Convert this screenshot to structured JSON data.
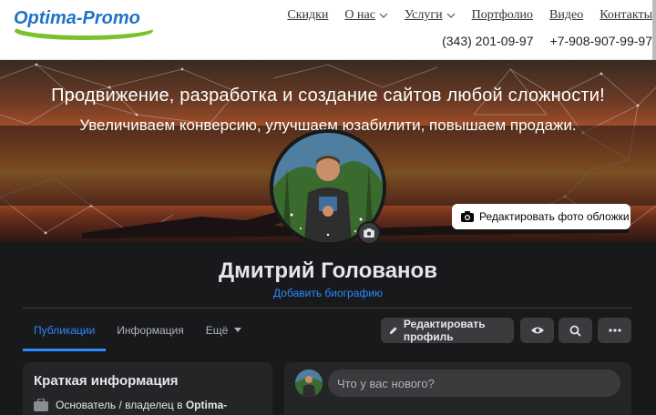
{
  "header": {
    "logo_text": "Optima-Promo",
    "nav": [
      {
        "label": "Скидки",
        "dropdown": false
      },
      {
        "label": "О нас",
        "dropdown": true
      },
      {
        "label": "Услуги",
        "dropdown": true
      },
      {
        "label": "Портфолио",
        "dropdown": false
      },
      {
        "label": "Видео",
        "dropdown": false
      },
      {
        "label": "Контакты",
        "dropdown": false
      }
    ],
    "phones": [
      "(343) 201-09-97",
      "+7-908-907-99-97"
    ]
  },
  "cover": {
    "title": "Продвижение, разработка и создание сайтов любой сложности!",
    "subtitle": "Увеличиваем конверсию, улучшаем юзабилити, повышаем продажи.",
    "edit_cover_label": "Редактировать фото обложки",
    "edit_cover_icon": "camera-icon"
  },
  "profile": {
    "name": "Дмитрий Голованов",
    "add_bio_label": "Добавить биографию"
  },
  "tabs": [
    {
      "label": "Публикации",
      "active": true
    },
    {
      "label": "Информация",
      "active": false
    },
    {
      "label": "Ещё",
      "active": false,
      "dropdown": true
    }
  ],
  "actions": {
    "edit_profile_label": "Редактировать профиль",
    "edit_profile_icon": "pencil-icon",
    "view_icon": "eye-icon",
    "search_icon": "search-icon",
    "more_icon": "more-horizontal-icon"
  },
  "intro": {
    "title": "Краткая информация",
    "row_prefix": "Основатель / владелец в ",
    "row_org": "Optima-",
    "row_icon": "briefcase-icon"
  },
  "composer": {
    "placeholder": "Что у вас нового?"
  },
  "colors": {
    "accent": "#2d88ff",
    "page_bg": "#18191a",
    "card_bg": "#242526",
    "button_bg": "#3a3b3c",
    "logo_blue": "#1e73c8",
    "logo_green": "#6fbf2a"
  }
}
